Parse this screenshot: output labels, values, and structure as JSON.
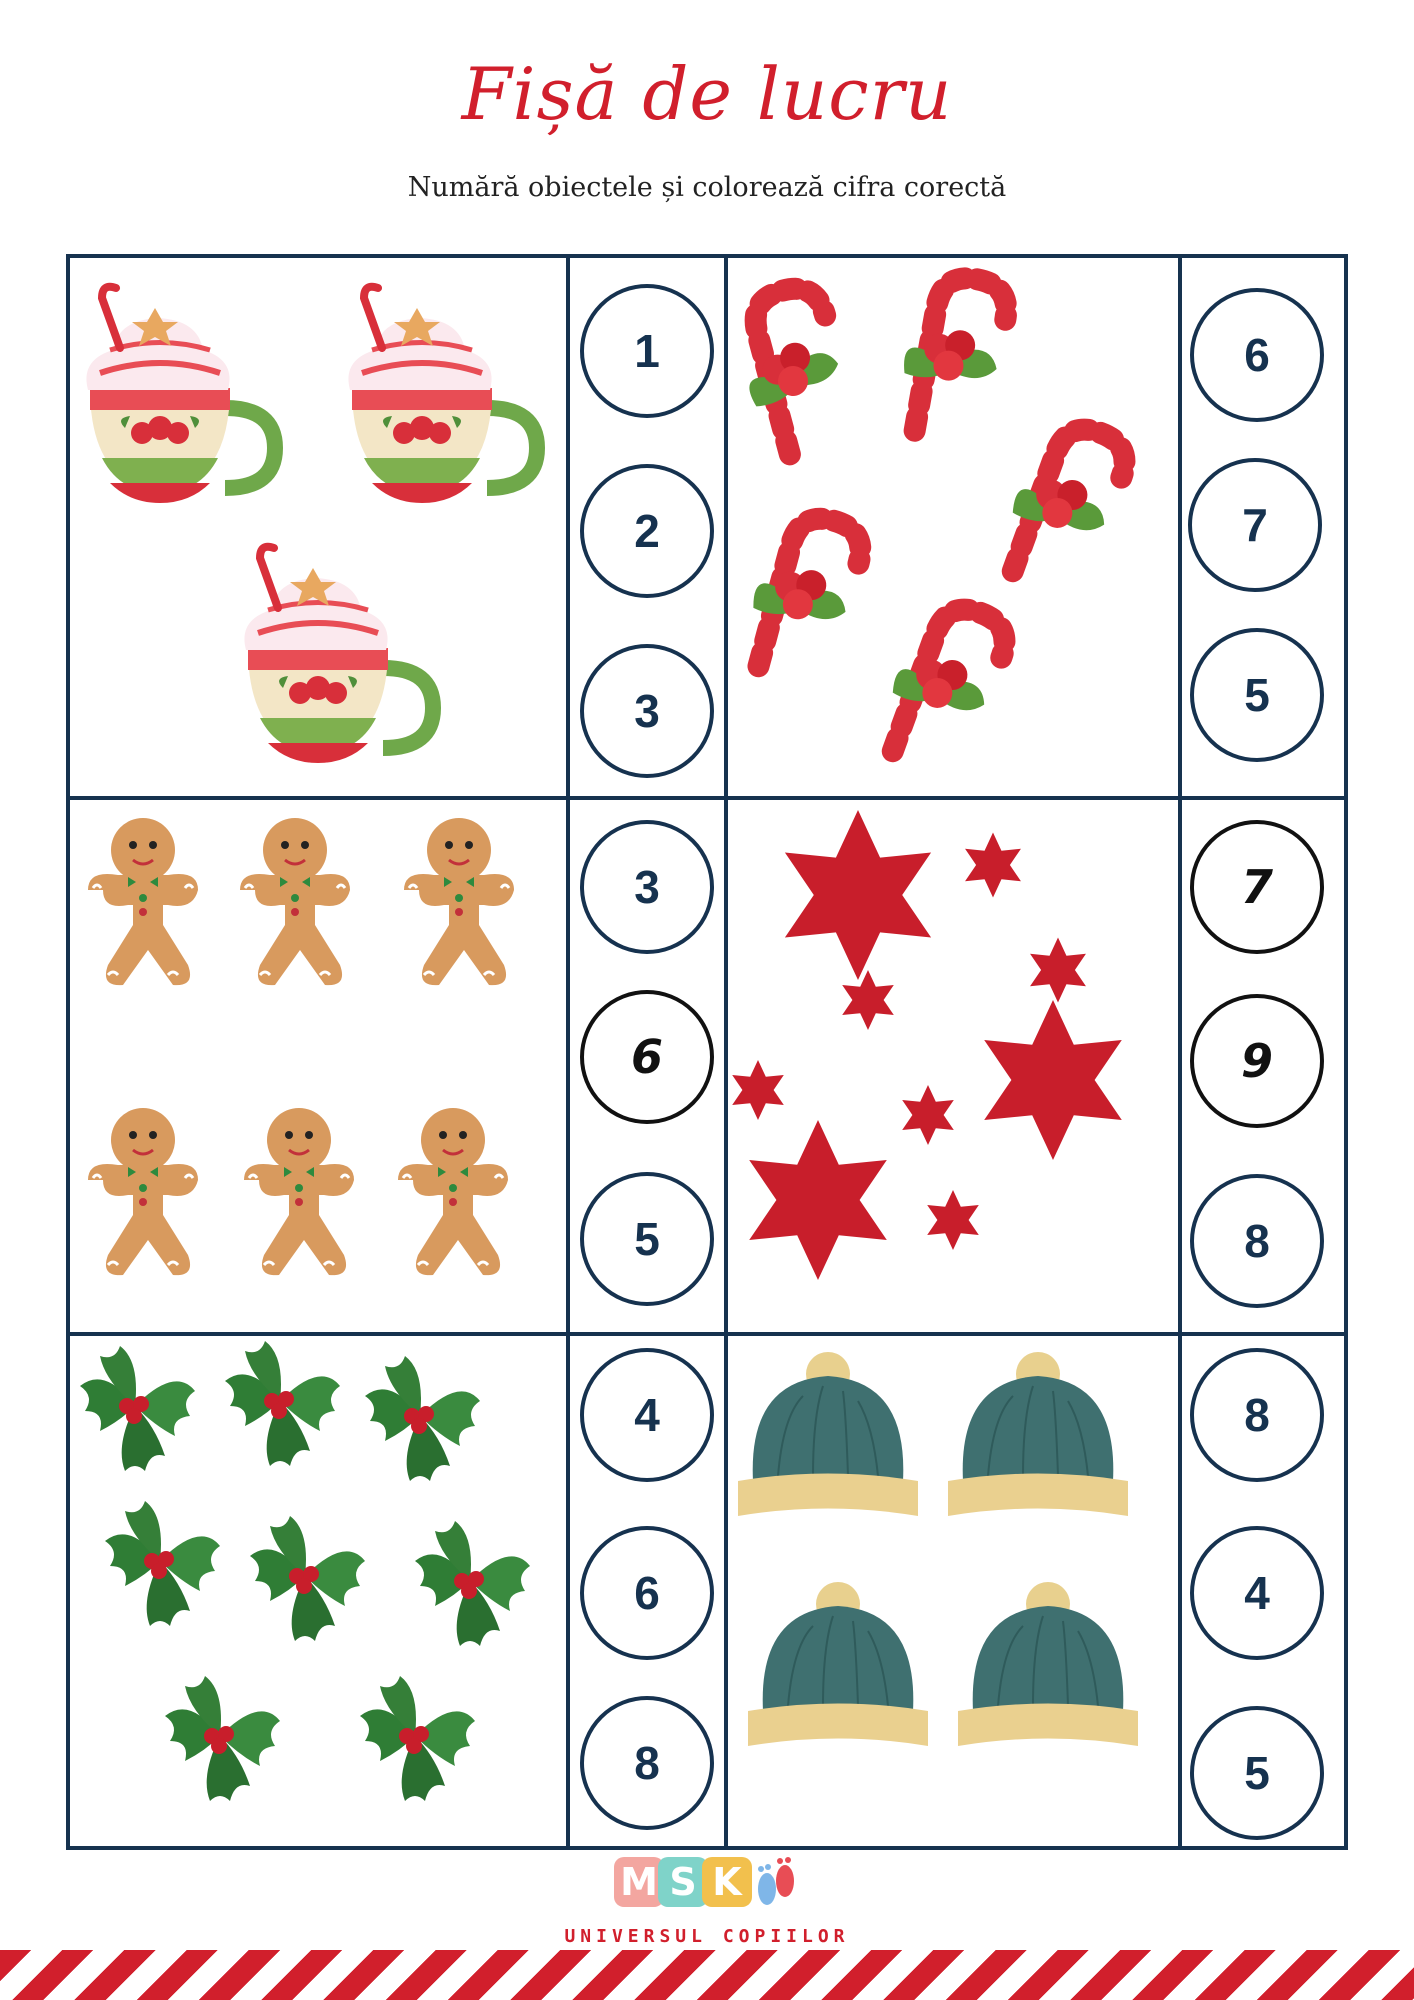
{
  "header": {
    "title": "Fișă de lucru",
    "subtitle": "Numără obiectele și colorează cifra corectă"
  },
  "exercises": [
    {
      "object": "hot-cocoa-mug",
      "options": [
        "1",
        "2",
        "3"
      ]
    },
    {
      "object": "candy-cane",
      "options": [
        "6",
        "7",
        "5"
      ]
    },
    {
      "object": "gingerbread-man",
      "options": [
        "3",
        "6",
        "5"
      ]
    },
    {
      "object": "red-star",
      "options": [
        "7",
        "9",
        "8"
      ]
    },
    {
      "object": "holly-leaf",
      "options": [
        "4",
        "6",
        "8"
      ]
    },
    {
      "object": "winter-hat",
      "options": [
        "8",
        "4",
        "5"
      ]
    }
  ],
  "footer": {
    "logo_letters": [
      "M",
      "S",
      "K"
    ],
    "brand": "UNIVERSUL COPIILOR"
  },
  "colors": {
    "accent": "#d11f2c",
    "grid": "#16324f",
    "logo": [
      "#f3a6a0",
      "#7fd3c9",
      "#f2c04d"
    ]
  }
}
